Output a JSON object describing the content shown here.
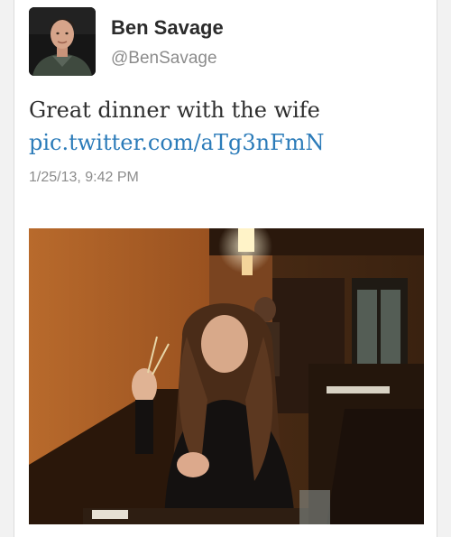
{
  "tweet": {
    "author": {
      "display_name": "Ben Savage",
      "handle": "@BenSavage",
      "avatar_icon": "profile-photo"
    },
    "text": "Great dinner with the wife",
    "link": "pic.twitter.com/aTg3nFmN",
    "timestamp": "1/25/13, 9:42 PM",
    "media": {
      "type": "photo",
      "icon": "restaurant-photo"
    }
  },
  "colors": {
    "link": "#2b7bb9",
    "name": "#2b2b2b",
    "meta": "#8c8c8c"
  }
}
